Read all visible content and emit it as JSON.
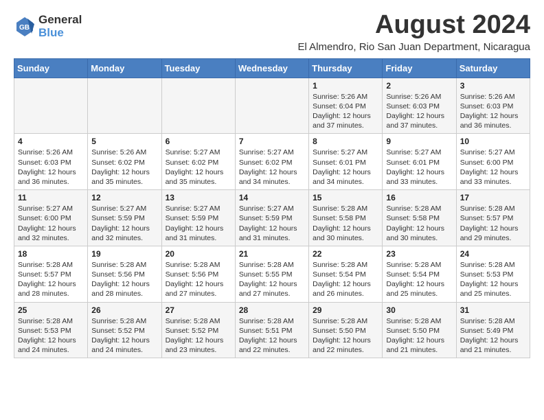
{
  "logo": {
    "general": "General",
    "blue": "Blue"
  },
  "title": "August 2024",
  "subtitle": "El Almendro, Rio San Juan Department, Nicaragua",
  "calendar": {
    "headers": [
      "Sunday",
      "Monday",
      "Tuesday",
      "Wednesday",
      "Thursday",
      "Friday",
      "Saturday"
    ],
    "weeks": [
      [
        {
          "day": "",
          "info": ""
        },
        {
          "day": "",
          "info": ""
        },
        {
          "day": "",
          "info": ""
        },
        {
          "day": "",
          "info": ""
        },
        {
          "day": "1",
          "info": "Sunrise: 5:26 AM\nSunset: 6:04 PM\nDaylight: 12 hours\nand 37 minutes."
        },
        {
          "day": "2",
          "info": "Sunrise: 5:26 AM\nSunset: 6:03 PM\nDaylight: 12 hours\nand 37 minutes."
        },
        {
          "day": "3",
          "info": "Sunrise: 5:26 AM\nSunset: 6:03 PM\nDaylight: 12 hours\nand 36 minutes."
        }
      ],
      [
        {
          "day": "4",
          "info": "Sunrise: 5:26 AM\nSunset: 6:03 PM\nDaylight: 12 hours\nand 36 minutes."
        },
        {
          "day": "5",
          "info": "Sunrise: 5:26 AM\nSunset: 6:02 PM\nDaylight: 12 hours\nand 35 minutes."
        },
        {
          "day": "6",
          "info": "Sunrise: 5:27 AM\nSunset: 6:02 PM\nDaylight: 12 hours\nand 35 minutes."
        },
        {
          "day": "7",
          "info": "Sunrise: 5:27 AM\nSunset: 6:02 PM\nDaylight: 12 hours\nand 34 minutes."
        },
        {
          "day": "8",
          "info": "Sunrise: 5:27 AM\nSunset: 6:01 PM\nDaylight: 12 hours\nand 34 minutes."
        },
        {
          "day": "9",
          "info": "Sunrise: 5:27 AM\nSunset: 6:01 PM\nDaylight: 12 hours\nand 33 minutes."
        },
        {
          "day": "10",
          "info": "Sunrise: 5:27 AM\nSunset: 6:00 PM\nDaylight: 12 hours\nand 33 minutes."
        }
      ],
      [
        {
          "day": "11",
          "info": "Sunrise: 5:27 AM\nSunset: 6:00 PM\nDaylight: 12 hours\nand 32 minutes."
        },
        {
          "day": "12",
          "info": "Sunrise: 5:27 AM\nSunset: 5:59 PM\nDaylight: 12 hours\nand 32 minutes."
        },
        {
          "day": "13",
          "info": "Sunrise: 5:27 AM\nSunset: 5:59 PM\nDaylight: 12 hours\nand 31 minutes."
        },
        {
          "day": "14",
          "info": "Sunrise: 5:27 AM\nSunset: 5:59 PM\nDaylight: 12 hours\nand 31 minutes."
        },
        {
          "day": "15",
          "info": "Sunrise: 5:28 AM\nSunset: 5:58 PM\nDaylight: 12 hours\nand 30 minutes."
        },
        {
          "day": "16",
          "info": "Sunrise: 5:28 AM\nSunset: 5:58 PM\nDaylight: 12 hours\nand 30 minutes."
        },
        {
          "day": "17",
          "info": "Sunrise: 5:28 AM\nSunset: 5:57 PM\nDaylight: 12 hours\nand 29 minutes."
        }
      ],
      [
        {
          "day": "18",
          "info": "Sunrise: 5:28 AM\nSunset: 5:57 PM\nDaylight: 12 hours\nand 28 minutes."
        },
        {
          "day": "19",
          "info": "Sunrise: 5:28 AM\nSunset: 5:56 PM\nDaylight: 12 hours\nand 28 minutes."
        },
        {
          "day": "20",
          "info": "Sunrise: 5:28 AM\nSunset: 5:56 PM\nDaylight: 12 hours\nand 27 minutes."
        },
        {
          "day": "21",
          "info": "Sunrise: 5:28 AM\nSunset: 5:55 PM\nDaylight: 12 hours\nand 27 minutes."
        },
        {
          "day": "22",
          "info": "Sunrise: 5:28 AM\nSunset: 5:54 PM\nDaylight: 12 hours\nand 26 minutes."
        },
        {
          "day": "23",
          "info": "Sunrise: 5:28 AM\nSunset: 5:54 PM\nDaylight: 12 hours\nand 25 minutes."
        },
        {
          "day": "24",
          "info": "Sunrise: 5:28 AM\nSunset: 5:53 PM\nDaylight: 12 hours\nand 25 minutes."
        }
      ],
      [
        {
          "day": "25",
          "info": "Sunrise: 5:28 AM\nSunset: 5:53 PM\nDaylight: 12 hours\nand 24 minutes."
        },
        {
          "day": "26",
          "info": "Sunrise: 5:28 AM\nSunset: 5:52 PM\nDaylight: 12 hours\nand 24 minutes."
        },
        {
          "day": "27",
          "info": "Sunrise: 5:28 AM\nSunset: 5:52 PM\nDaylight: 12 hours\nand 23 minutes."
        },
        {
          "day": "28",
          "info": "Sunrise: 5:28 AM\nSunset: 5:51 PM\nDaylight: 12 hours\nand 22 minutes."
        },
        {
          "day": "29",
          "info": "Sunrise: 5:28 AM\nSunset: 5:50 PM\nDaylight: 12 hours\nand 22 minutes."
        },
        {
          "day": "30",
          "info": "Sunrise: 5:28 AM\nSunset: 5:50 PM\nDaylight: 12 hours\nand 21 minutes."
        },
        {
          "day": "31",
          "info": "Sunrise: 5:28 AM\nSunset: 5:49 PM\nDaylight: 12 hours\nand 21 minutes."
        }
      ]
    ]
  }
}
